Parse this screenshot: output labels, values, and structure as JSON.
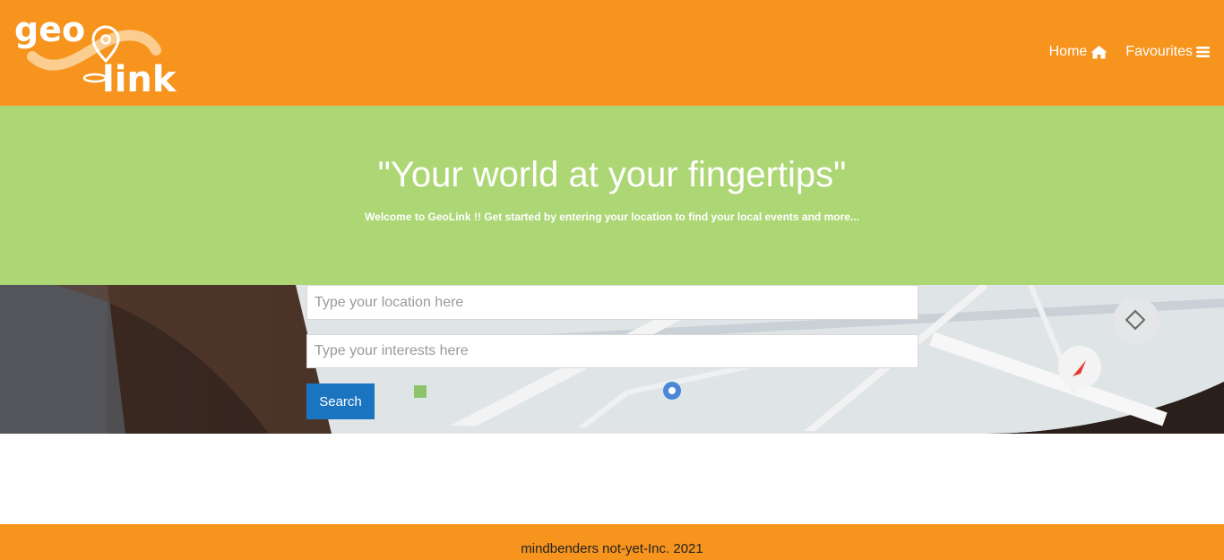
{
  "header": {
    "logo": {
      "word_top": "geo",
      "word_bottom": "link"
    },
    "nav": [
      {
        "label": "Home",
        "icon": "home-icon"
      },
      {
        "label": "Favourites",
        "icon": "menu-icon"
      }
    ]
  },
  "hero": {
    "title": "\"Your world at your fingertips\"",
    "subtitle": "Welcome to GeoLink !! Get started by entering your location to find your local events and more..."
  },
  "search": {
    "location_placeholder": "Type your location here",
    "location_value": "",
    "interests_placeholder": "Type your interests here",
    "interests_value": "",
    "button_label": "Search"
  },
  "footer": {
    "text": "mindbenders not-yet-Inc. 2021"
  },
  "colors": {
    "brand_orange": "#f7941e",
    "hero_green": "#add675",
    "button_blue": "#1a74bf"
  }
}
